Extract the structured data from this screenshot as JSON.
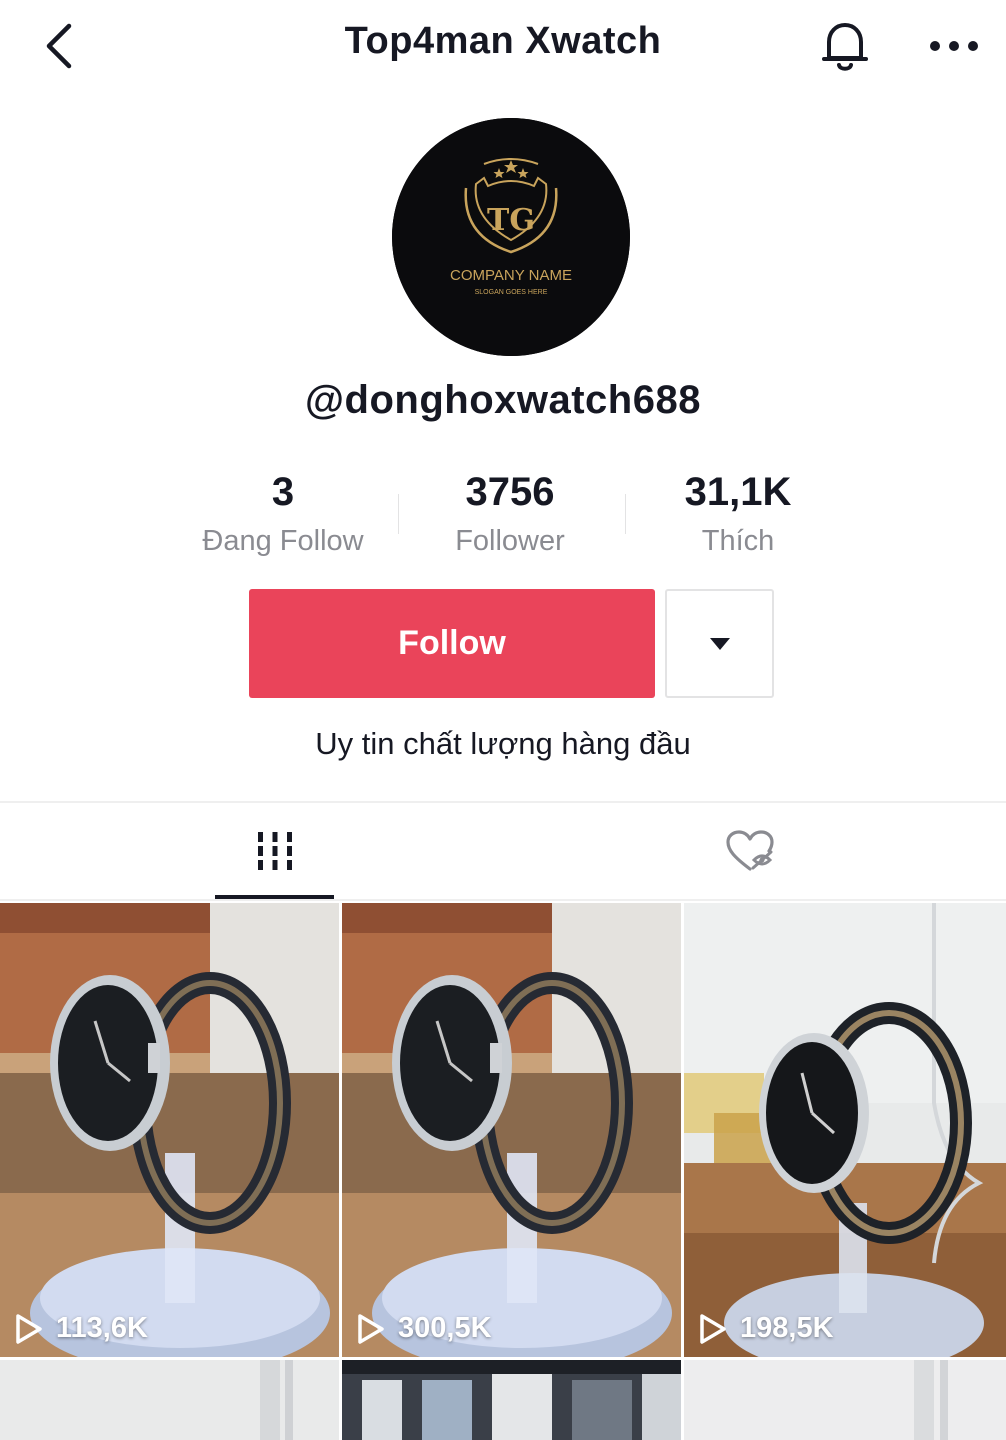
{
  "header": {
    "title": "Top4man Xwatch"
  },
  "avatar": {
    "logo_title": "COMPANY NAME",
    "logo_slogan": "SLOGAN GOES HERE",
    "logo_monogram": "TG"
  },
  "profile": {
    "username": "@donghoxwatch688",
    "bio": "Uy tin chất lượng hàng đầu"
  },
  "stats": [
    {
      "value": "3",
      "label": "Đang Follow"
    },
    {
      "value": "3756",
      "label": "Follower"
    },
    {
      "value": "31,1K",
      "label": "Thích"
    }
  ],
  "actions": {
    "follow_label": "Follow"
  },
  "tabs": [
    {
      "name": "videos",
      "icon": "grid-lines-icon",
      "active": true
    },
    {
      "name": "liked",
      "icon": "heart-hidden-icon",
      "active": false
    }
  ],
  "videos": [
    {
      "views": "113,6K"
    },
    {
      "views": "300,5K"
    },
    {
      "views": "198,5K"
    }
  ],
  "colors": {
    "follow_button": "#ea445a",
    "text_primary": "#161823",
    "text_secondary": "#8a8b91"
  }
}
